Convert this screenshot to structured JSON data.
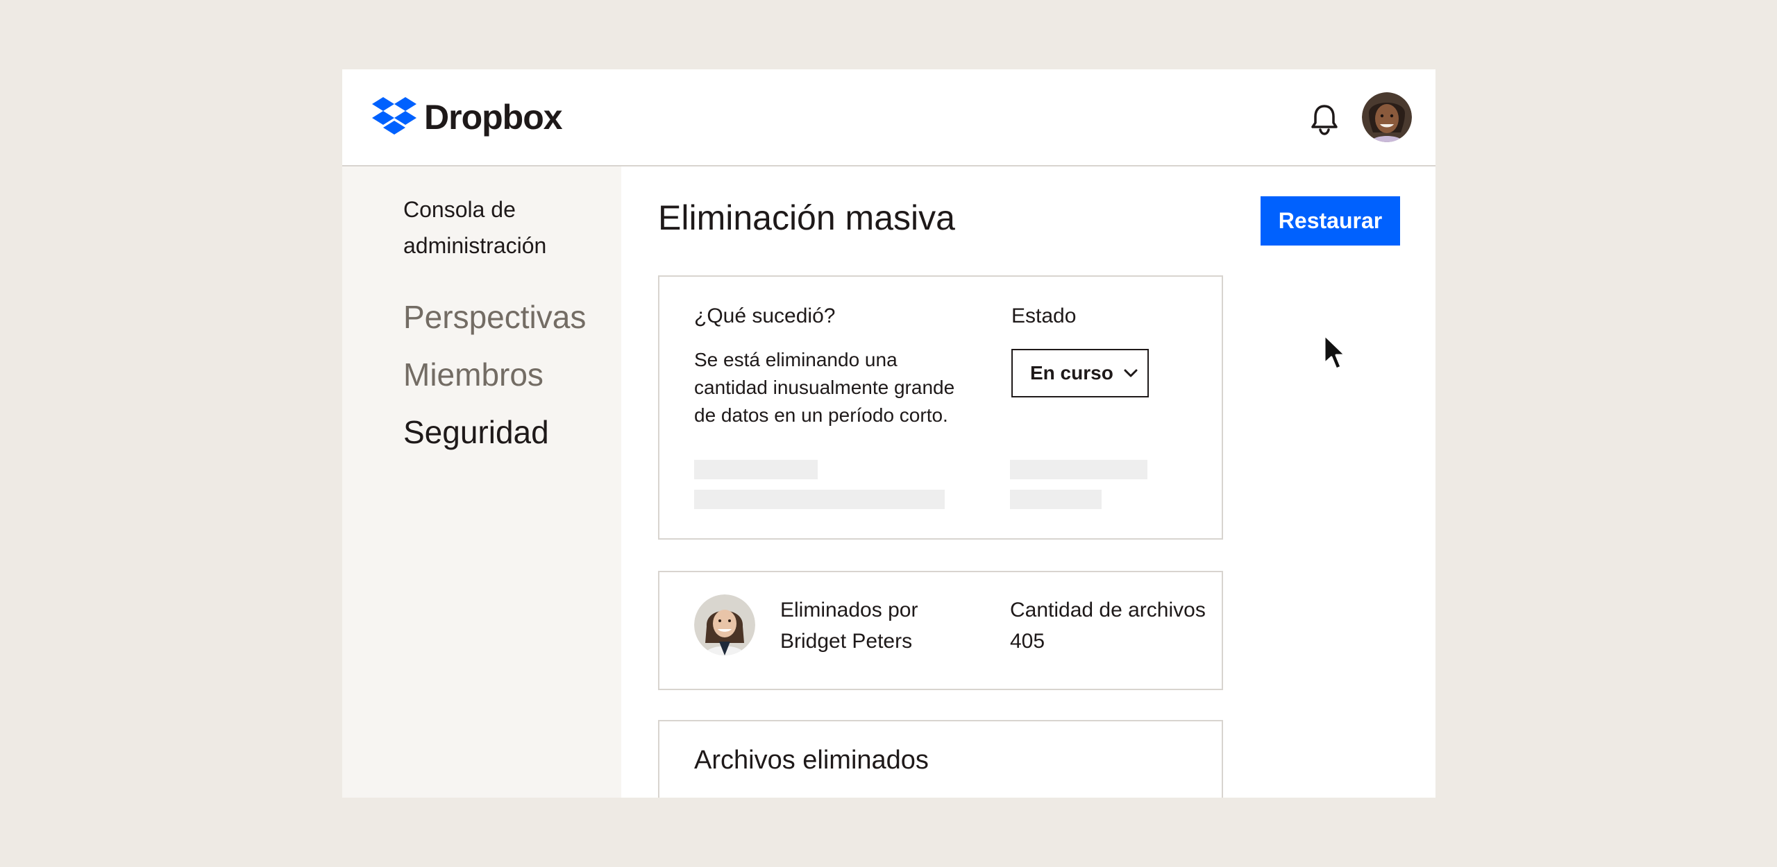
{
  "header": {
    "brand": "Dropbox",
    "colors": {
      "brand_blue": "#0061fe"
    },
    "icons": {
      "notifications": "bell-icon",
      "user": "avatar"
    }
  },
  "sidebar": {
    "title": "Consola de administración",
    "items": [
      {
        "label": "Perspectivas",
        "active": false
      },
      {
        "label": "Miembros",
        "active": false
      },
      {
        "label": "Seguridad",
        "active": true
      }
    ]
  },
  "main": {
    "title": "Eliminación masiva",
    "restore_label": "Restaurar",
    "incident": {
      "what_label": "¿Qué sucedió?",
      "what_text": "Se está eliminando una cantidad inusualmente grande de datos en un período corto.",
      "status_label": "Estado",
      "status_value": "En curso"
    },
    "deleted_by": {
      "label": "Eliminados por",
      "name": "Bridget Peters",
      "count_label": "Cantidad de archivos",
      "count_value": "405"
    },
    "files_title": "Archivos eliminados"
  }
}
